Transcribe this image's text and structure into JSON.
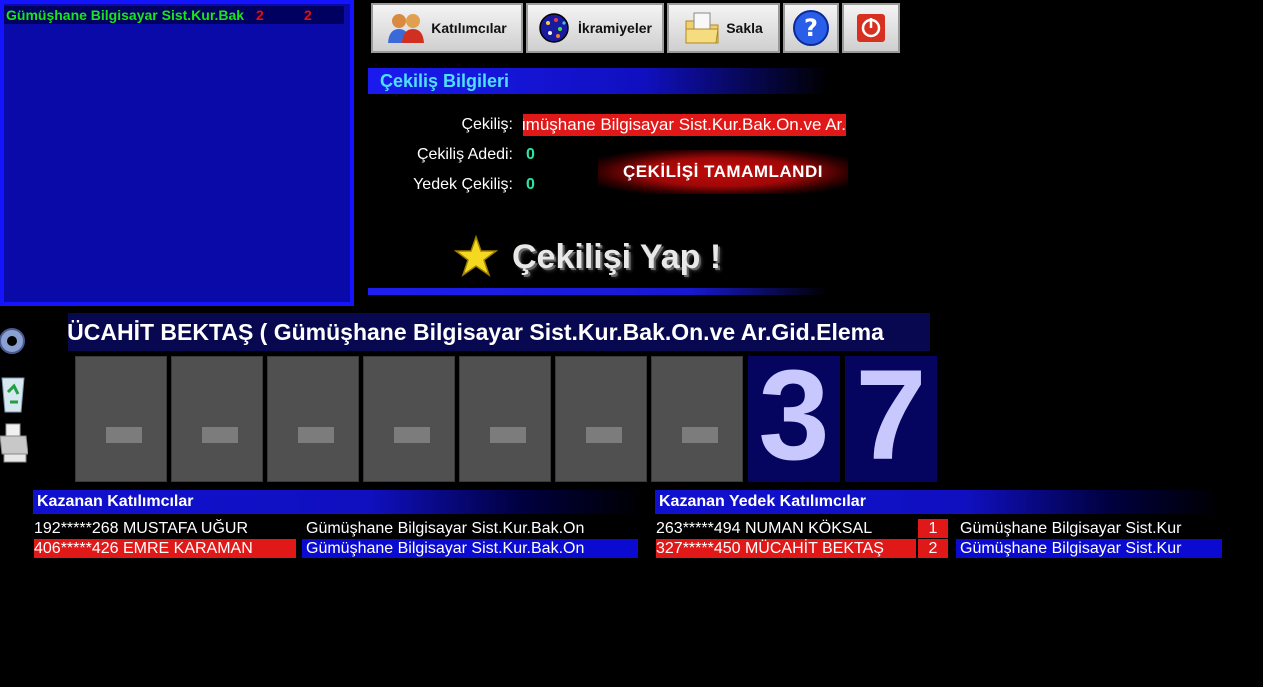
{
  "list": {
    "row_name": "Gümüşhane Bilgisayar Sist.Kur.Bak",
    "row_num1": "2",
    "row_num2": "2"
  },
  "toolbar": {
    "participants_label": "Katılımcılar",
    "prizes_label": "İkramiyeler",
    "save_label": "Sakla",
    "help_icon": "question-icon",
    "exit_icon": "power-icon"
  },
  "draw_info": {
    "header": "Çekiliş Bilgileri",
    "draw_label": "Çekiliş:",
    "draw_value": "Gümüşhane Bilgisayar Sist.Kur.Bak.On.ve Ar.Gi",
    "count_label": "Çekiliş Adedi:",
    "count_value": "0",
    "reserve_label": "Yedek Çekiliş:",
    "reserve_value": "0",
    "status": "ÇEKİLİŞİ  TAMAMLANDI",
    "do_draw_label": "Çekilişi Yap !"
  },
  "ticker": {
    "text": "MÜCAHİT BEKTAŞ   ( Gümüşhane Bilgisayar Sist.Kur.Bak.On.ve Ar.Gid.Elema"
  },
  "digits": [
    "-",
    "-",
    "-",
    "-",
    "-",
    "-",
    "-",
    "3",
    "7"
  ],
  "winners": {
    "header": "Kazanan Katılımcılar",
    "rows": [
      {
        "id": "192*****268 MUSTAFA UĞUR",
        "draw": "Gümüşhane Bilgisayar Sist.Kur.Bak.On"
      },
      {
        "id": "406*****426 EMRE KARAMAN",
        "draw": "Gümüşhane Bilgisayar Sist.Kur.Bak.On"
      }
    ]
  },
  "reserve_winners": {
    "header": "Kazanan Yedek Katılımcılar",
    "rows": [
      {
        "id": "263*****494 NUMAN KÖKSAL",
        "rank": "1",
        "draw": "Gümüşhane Bilgisayar Sist.Kur"
      },
      {
        "id": "327*****450 MÜCAHİT BEKTAŞ",
        "rank": "2",
        "draw": "Gümüşhane Bilgisayar Sist.Kur"
      }
    ]
  },
  "colors": {
    "panel_blue": "#0a0aa8",
    "accent_red": "#e01818",
    "digit_gray": "#505050",
    "digit_blue": "#050560",
    "info_cyan": "#4de0ff",
    "value_green": "#28e6a8"
  }
}
